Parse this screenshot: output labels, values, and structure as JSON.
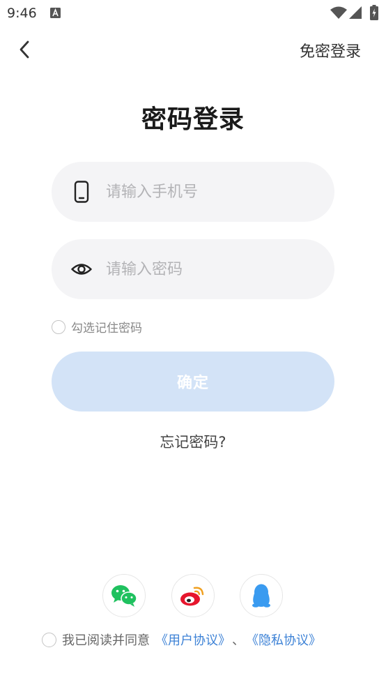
{
  "status_bar": {
    "time": "9:46"
  },
  "header": {
    "right_link": "免密登录"
  },
  "title": "密码登录",
  "form": {
    "phone_placeholder": "请输入手机号",
    "password_placeholder": "请输入密码",
    "remember_label": "勾选记住密码",
    "remember_checked": false,
    "confirm_label": "确定",
    "forgot_label": "忘记密码?"
  },
  "social_login": [
    {
      "icon": "wechat-icon"
    },
    {
      "icon": "weibo-icon"
    },
    {
      "icon": "qq-icon"
    }
  ],
  "agreement": {
    "prefix": "我已阅读并同意",
    "user_agreement": "《用户协议》",
    "separator": "、",
    "privacy_agreement": "《隐私协议》",
    "checked": false
  },
  "colors": {
    "accent": "#3d82d6",
    "button_disabled": "#d3e3f7",
    "field_bg": "#f4f4f6",
    "wechat": "#1fc15f",
    "weibo": "#e6162d",
    "qq": "#3a9bf0"
  }
}
